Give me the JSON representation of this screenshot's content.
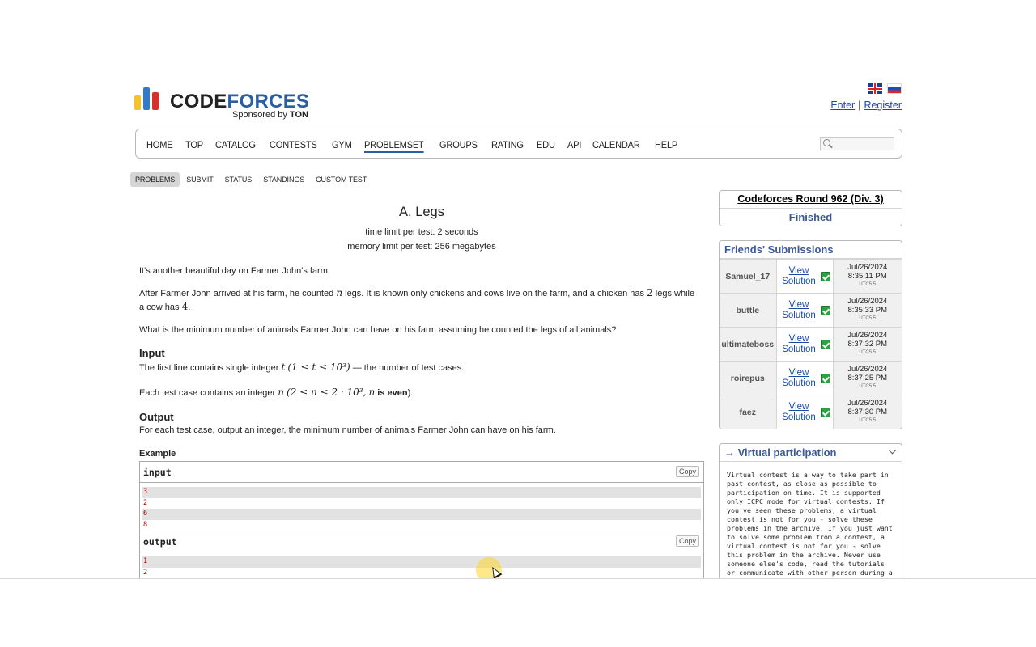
{
  "header": {
    "logo_word_1": "CODE",
    "logo_word_2": "FORCES",
    "sponsor_prefix": "Sponsored by",
    "sponsor_name": "TON",
    "enter_label": "Enter",
    "separator": "|",
    "register_label": "Register"
  },
  "nav": {
    "items": [
      "HOME",
      "TOP",
      "CATALOG",
      "CONTESTS",
      "GYM",
      "PROBLEMSET",
      "GROUPS",
      "RATING",
      "EDU",
      "API",
      "CALENDAR",
      "HELP"
    ],
    "active": "PROBLEMSET",
    "search_placeholder": ""
  },
  "subtabs": {
    "items": [
      "PROBLEMS",
      "SUBMIT",
      "STATUS",
      "STANDINGS",
      "CUSTOM TEST"
    ],
    "active": "PROBLEMS"
  },
  "problem": {
    "title": "A. Legs",
    "time_limit": "time limit per test: 2 seconds",
    "memory_limit": "memory limit per test: 256 megabytes",
    "para1": "It's another beautiful day on Farmer John's farm.",
    "para2_a": "After Farmer John arrived at his farm, he counted ",
    "para2_n": "n",
    "para2_b": " legs. It is known only chickens and cows live on the farm, and a chicken has ",
    "para2_two": "2",
    "para2_c": " legs while a cow has ",
    "para2_four": "4",
    "para2_d": ".",
    "para3": "What is the minimum number of animals Farmer John can have on his farm assuming he counted the legs of all animals?",
    "input_heading": "Input",
    "input_line1_a": "The first line contains single integer ",
    "input_line1_t": "t",
    "input_line1_math": "(1 ≤ t ≤ 10³)",
    "input_line1_b": " — the number of test cases.",
    "input_line2_a": "Each test case contains an integer ",
    "input_line2_n": "n",
    "input_line2_math": "(2 ≤ n ≤ 2 · 10³,",
    "input_line2_n2": "n",
    "input_line2_even": " is even",
    "input_line2_close": ").",
    "output_heading": "Output",
    "output_text": "For each test case, output an integer, the minimum number of animals Farmer John can have on his farm.",
    "example_heading": "Example",
    "input_label": "input",
    "output_label": "output",
    "copy_label": "Copy",
    "sample_input": [
      "3",
      "2",
      "6",
      "8"
    ],
    "sample_output": [
      "1",
      "2"
    ]
  },
  "sidebar": {
    "contest_name": "Codeforces Round 962 (Div. 3)",
    "contest_phase": "Finished",
    "friends_title": "Friends' Submissions",
    "view_label_1": "View",
    "view_label_2": "Solution",
    "submissions": [
      {
        "user": "Samuel_17",
        "date": "Jul/26/2024",
        "time": "8:35:11 PM",
        "tz": "UTC5.5"
      },
      {
        "user": "buttle",
        "date": "Jul/26/2024",
        "time": "8:35:33 PM",
        "tz": "UTC5.5"
      },
      {
        "user": "ultimateboss",
        "date": "Jul/26/2024",
        "time": "8:37:32 PM",
        "tz": "UTC5.5"
      },
      {
        "user": "roirepus",
        "date": "Jul/26/2024",
        "time": "8:37:25 PM",
        "tz": "UTC5.5"
      },
      {
        "user": "faez",
        "date": "Jul/26/2024",
        "time": "8:37:30 PM",
        "tz": "UTC5.5"
      }
    ],
    "virtual_title": "→ Virtual participation",
    "virtual_text": "Virtual contest is a way to take part in past contest, as close as possible to participation on time. It is supported only ICPC mode for virtual contests. If you've seen these problems, a virtual contest is not for you - solve these problems in the archive. If you just want to solve some problem from a contest, a virtual contest is not for you - solve this problem in the archive. Never use someone else's code, read the tutorials or communicate with other person during a virtual contest."
  },
  "colors": {
    "brand_blue": "#2b5da1",
    "link_blue": "#1a49a6",
    "sidebar_title": "#3b5998",
    "accepted_green": "#2ea043",
    "sample_text": "#aa0000",
    "cursor_highlight": "#ffd628"
  },
  "icons": [
    "codeforces-logo-icon",
    "uk-flag-icon",
    "ru-flag-icon",
    "search-icon",
    "accepted-check-icon",
    "chevron-down-icon",
    "mouse-cursor-icon"
  ]
}
